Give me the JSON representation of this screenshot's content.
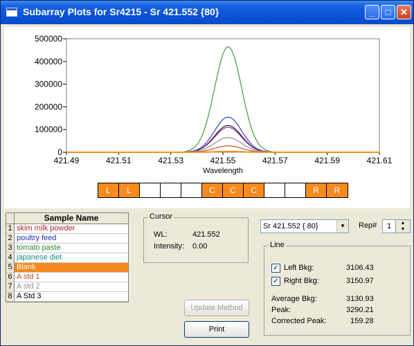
{
  "window": {
    "title": "Subarray Plots for Sr4215 - Sr 421.552 {80}",
    "minimize_glyph": "_",
    "maximize_glyph": "□",
    "close_glyph": "✕"
  },
  "chart_data": {
    "type": "line",
    "xlabel": "Wavelength",
    "ylabel": "",
    "xlim": [
      421.49,
      421.61
    ],
    "ylim": [
      0,
      500000
    ],
    "x_ticks": [
      "421.49",
      "421.51",
      "421.53",
      "421.55",
      "421.57",
      "421.59",
      "421.61"
    ],
    "y_ticks": [
      "0",
      "100000",
      "200000",
      "300000",
      "400000",
      "500000"
    ],
    "peak_center": 421.552,
    "grid": false,
    "series": [
      {
        "color": "#3a9a3a",
        "peak": 465000
      },
      {
        "color": "#3a3ad0",
        "peak": 155000
      },
      {
        "color": "#202020",
        "peak": 118000
      },
      {
        "color": "#8a2a8a",
        "peak": 110000
      },
      {
        "color": "#909090",
        "peak": 65000
      },
      {
        "color": "#c05020",
        "peak": 28000
      },
      {
        "color": "#f58a1f",
        "peak": 3290
      }
    ]
  },
  "regions": [
    "L",
    "L",
    "",
    "",
    "",
    "C",
    "C",
    "C",
    "",
    "",
    "R",
    "R"
  ],
  "samples": {
    "header": "Sample Name",
    "rows": [
      {
        "num": "1",
        "name": "skim milk powder",
        "color": "#b22222"
      },
      {
        "num": "2",
        "name": "poultry feed",
        "color": "#2233aa"
      },
      {
        "num": "3",
        "name": "tomato paste",
        "color": "#2a8a2a"
      },
      {
        "num": "4",
        "name": "japanese diet",
        "color": "#1c8c8c"
      },
      {
        "num": "5",
        "name": "Blank",
        "color": "#ffffff",
        "selected": true
      },
      {
        "num": "6",
        "name": "A std 1",
        "color": "#c05020"
      },
      {
        "num": "7",
        "name": "A std 2",
        "color": "#909090"
      },
      {
        "num": "8",
        "name": "A Std 3",
        "color": "#000000"
      }
    ]
  },
  "cursor": {
    "label": "Cursor",
    "wl_label": "WL:",
    "wl_value": "421.552",
    "intensity_label": "Intensity:",
    "intensity_value": "0.00"
  },
  "buttons": {
    "update_method": "Update Method",
    "print": "Print"
  },
  "line_select": {
    "value": "Sr 421.552 { 80}",
    "rep_label": "Rep#",
    "rep_value": "1"
  },
  "line": {
    "label": "Line",
    "left_bkg_label": "Left Bkg:",
    "left_bkg_value": "3106.43",
    "right_bkg_label": "Right Bkg:",
    "right_bkg_value": "3150.97",
    "avg_bkg_label": "Average Bkg:",
    "avg_bkg_value": "3130.93",
    "peak_label": "Peak:",
    "peak_value": "3290.21",
    "corrected_peak_label": "Corrected Peak:",
    "corrected_peak_value": "159.28",
    "checkmark": "✓"
  }
}
